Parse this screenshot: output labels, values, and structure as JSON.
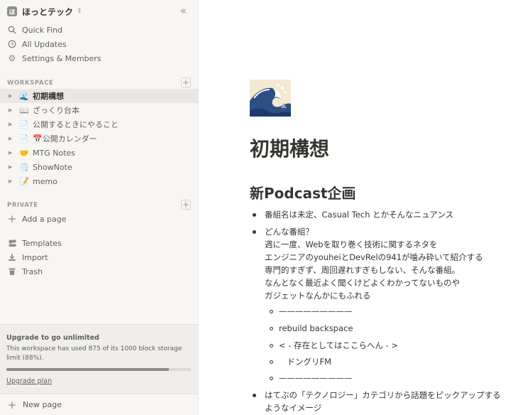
{
  "sidebar": {
    "workspace": {
      "badge": "ほ",
      "name": "ほっとテック",
      "switch_icon": "chevron-updown-icon",
      "collapse_icon": "double-chevron-left-icon"
    },
    "menu": [
      {
        "label": "Quick Find",
        "icon": "search-icon"
      },
      {
        "label": "All Updates",
        "icon": "clock-icon"
      },
      {
        "label": "Settings & Members",
        "icon": "gear-icon"
      }
    ],
    "workspace_label": "WORKSPACE",
    "pages": [
      {
        "emoji": "🌊",
        "label": "初期構想",
        "active": true
      },
      {
        "emoji": "📖",
        "label": "ざっくり台本"
      },
      {
        "emoji": "📄",
        "label": "公開するときにやること"
      },
      {
        "emoji": "📄",
        "label": "📅公開カレンダー"
      },
      {
        "emoji": "🤝",
        "label": "MTG Notes"
      },
      {
        "emoji": "🗒️",
        "label": "ShowNote"
      },
      {
        "emoji": "📝",
        "label": "memo"
      }
    ],
    "private_label": "PRIVATE",
    "add_page": "Add a page",
    "tools": [
      {
        "label": "Templates",
        "icon": "templates-icon"
      },
      {
        "label": "Import",
        "icon": "import-icon"
      },
      {
        "label": "Trash",
        "icon": "trash-icon"
      }
    ],
    "upgrade": {
      "title": "Upgrade to go unlimited",
      "desc": "This workspace has used 875 of its 1000 block storage limit (88%).",
      "used_fraction": 0.88,
      "link": "Upgrade plan"
    },
    "new_page": "New page"
  },
  "main": {
    "icon": "great-wave-emoji-icon",
    "title": "初期構想",
    "heading": "新Podcast企画",
    "bullets": [
      {
        "lines": [
          "番組名は未定、Casual Tech とかそんなニュアンス"
        ]
      },
      {
        "lines": [
          "どんな番組？",
          "週に一度、Webを取り巻く技術に関するネタを",
          "エンジニアのyouheiとDevRelの941が噛み砕いて紹介する",
          "専門的すぎず、周回遅れすぎもしない、そんな番組。",
          "なんとなく最近よく聞くけどよくわかってないものや",
          "ガジェットなんかにもふれる"
        ]
      },
      {
        "lines": [
          "はてぶの「テクノロジー」カテゴリから話題をピックアップする",
          "ようなイメージ"
        ]
      }
    ],
    "sub_items": [
      "—————————",
      "rebuild backspace",
      "< - 存在としてはここらへん - >",
      "　ドングリFM",
      "—————————"
    ]
  }
}
